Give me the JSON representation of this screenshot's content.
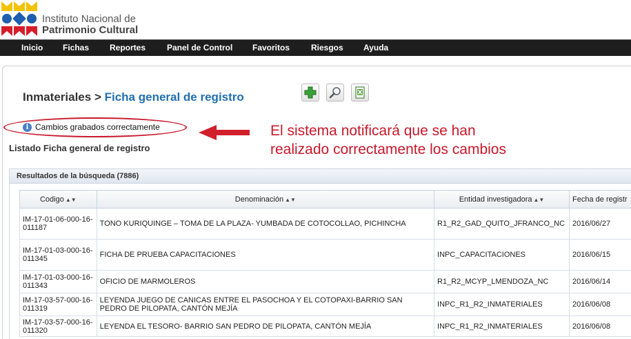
{
  "logo": {
    "line1": "Instituto Nacional de",
    "line2": "Patrimonio Cultural"
  },
  "nav": [
    {
      "label": "Inicio"
    },
    {
      "label": "Fichas"
    },
    {
      "label": "Reportes"
    },
    {
      "label": "Panel de Control"
    },
    {
      "label": "Favoritos"
    },
    {
      "label": "Riesgos"
    },
    {
      "label": "Ayuda"
    }
  ],
  "breadcrumb": {
    "parent": "Inmateriales",
    "separator": " > ",
    "current": "Ficha general de registro"
  },
  "toolbar": {
    "icons": [
      "add-icon",
      "search-icon",
      "excel-export-icon"
    ]
  },
  "notice": {
    "text": "Cambios grabados correctamente"
  },
  "annotation": {
    "line1": "El sistema notificará que se han",
    "line2": "realizado correctamente los cambios"
  },
  "list_title": "Listado Ficha general de registro",
  "results": {
    "header": "Resultados de la búsqueda (7886)",
    "columns": [
      "Codigo",
      "Denominación",
      "Entidad investigadora",
      "Fecha de registr"
    ],
    "rows": [
      {
        "codigo": "IM-17-01-06-000-16-011187",
        "denominacion": "TONO KURIQUINGE – TOMA DE LA PLAZA- YUMBADA DE COTOCOLLAO, PICHINCHA",
        "entidad": "R1_R2_GAD_QUITO_JFRANCO_NC",
        "fecha": "2016/06/27"
      },
      {
        "codigo": "IM-17-01-03-000-16-011345",
        "denominacion": "FICHA DE PRUEBA CAPACITACIONES",
        "entidad": "INPC_CAPACITACIONES",
        "fecha": "2016/06/15"
      },
      {
        "codigo": "IM-17-01-03-000-16-011343",
        "denominacion": "OFICIO DE MARMOLEROS",
        "entidad": "R1_R2_MCYP_LMENDOZA_NC",
        "fecha": "2016/06/14"
      },
      {
        "codigo": "IM-17-03-57-000-16-011319",
        "denominacion": "LEYENDA JUEGO DE CANICAS ENTRE EL PASOCHOA Y EL COTOPAXI-BARRIO SAN PEDRO DE PILOPATA, CANTÓN MEJÍA",
        "entidad": "INPC_R1_R2_INMATERIALES",
        "fecha": "2016/06/08"
      },
      {
        "codigo": "IM-17-03-57-000-16-011320",
        "denominacion": "LEYENDA EL TESORO- BARRIO SAN PEDRO DE PILOPATA, CANTÓN MEJÍA",
        "entidad": "INPC_R1_R2_INMATERIALES",
        "fecha": "2016/06/08"
      }
    ]
  },
  "colors": {
    "accent_blue": "#1f6fb0",
    "annotation_red": "#c8182a",
    "navbar": "#1e1e1e"
  }
}
